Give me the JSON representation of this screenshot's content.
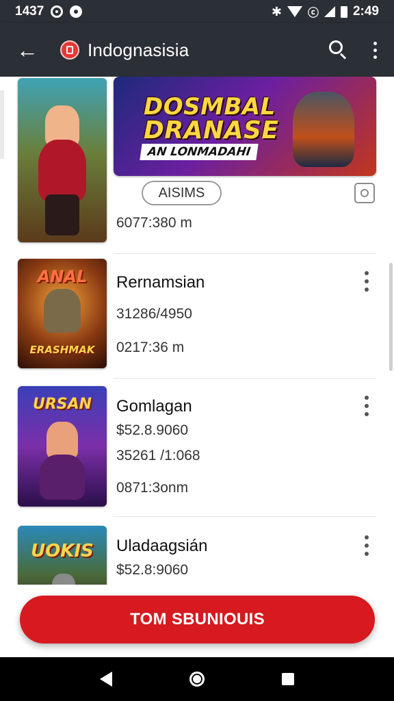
{
  "status_bar": {
    "time": "1437",
    "clock_right": "2:49",
    "sim_label": "ⓒ"
  },
  "app_bar": {
    "title": "Indognasisia"
  },
  "banner": {
    "line1": "DOSMBAL",
    "line2": "DRANASE",
    "sub": "AN LONMADAHI",
    "chip_label": "AISIMS",
    "meta": "6077:380 m"
  },
  "items": [
    {
      "title": "Rernamsian",
      "line1": "31286/4950",
      "line2": "0217:36 m",
      "thumb_text": "ANAL",
      "thumb_text2": "ERASHMAK"
    },
    {
      "title": "Gomlagan",
      "line1": "$52.8.9060",
      "line2": "35261 /1:068",
      "line3": "0871:3onm",
      "thumb_text": "URSAN",
      "thumb_text2": ""
    },
    {
      "title": "Uladaagsián",
      "line1": "$52.8:9060",
      "thumb_text": "UOKIS",
      "thumb_text2": ""
    }
  ],
  "cta": {
    "label": "TOM SBUNIOUIS"
  },
  "icons": {
    "back": "arrow-left-icon",
    "search": "search-icon",
    "more": "more-vert-icon",
    "share": "share-icon"
  },
  "colors": {
    "app_bar": "#2b2f36",
    "accent": "#d61a1f",
    "logo": "#e53935"
  }
}
